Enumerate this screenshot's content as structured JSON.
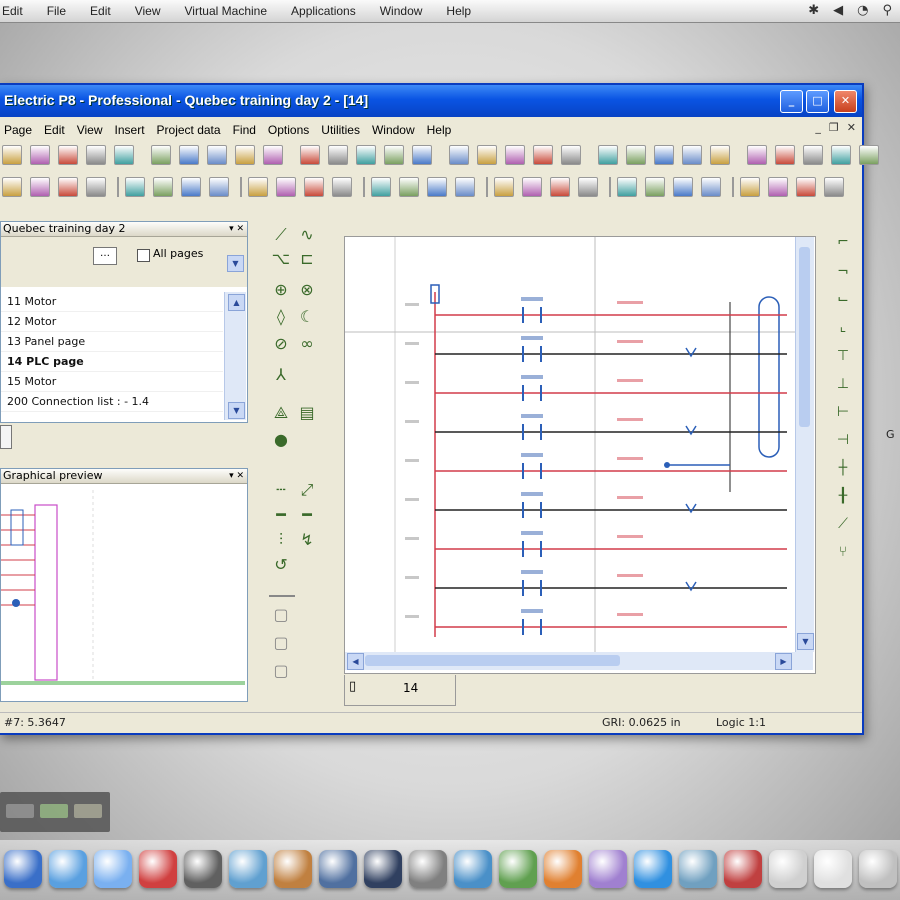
{
  "mac_menu": [
    "Edit",
    "File",
    "Edit",
    "View",
    "Virtual Machine",
    "Applications",
    "Window",
    "Help"
  ],
  "window": {
    "title": "Electric P8 - Professional - Quebec training day 2 - [14]",
    "menus": [
      "Page",
      "Edit",
      "View",
      "Insert",
      "Project data",
      "Find",
      "Options",
      "Utilities",
      "Window",
      "Help"
    ]
  },
  "page_navigator": {
    "title": "Quebec training day 2",
    "checkbox_label": "All pages",
    "pages": [
      "11 Motor",
      "12 Motor",
      "13 Panel page",
      "14 PLC page",
      "15 Motor",
      "200 Connection list : - 1.4"
    ],
    "selected_index": 3
  },
  "preview_panel": {
    "title": "Graphical preview"
  },
  "page_tab": {
    "label": "14"
  },
  "status": {
    "left": "#7: 5.3647",
    "grid": "GRI: 0.0625 in",
    "logic": "Logic 1:1"
  },
  "colors": {
    "wire_red": "#d23c4a",
    "wire_black": "#222222",
    "title_blue": "#0a54e3",
    "symbol_blue": "#2b5fb8"
  }
}
